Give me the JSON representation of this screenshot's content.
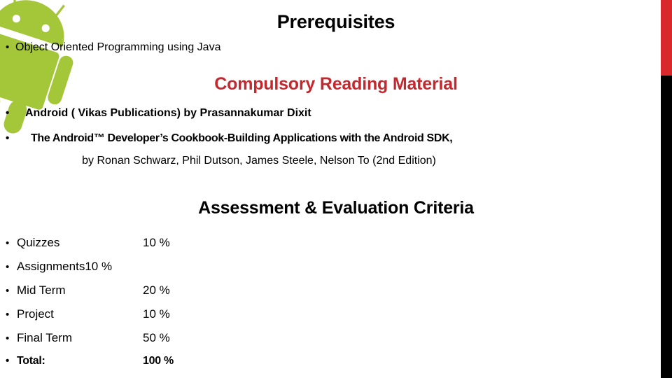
{
  "slide": {
    "title": "Prerequisites",
    "prerequisites": [
      {
        "bullet": "•",
        "text": "Object Oriented Programming using Java"
      }
    ],
    "reading_heading": "Compulsory Reading Material",
    "reading_items": [
      {
        "bullet": "•",
        "text": "Android ( Vikas Publications) by Prasannakumar Dixit"
      },
      {
        "bullet": "•",
        "text": "The Android™ Developer’s Cookbook-Building Applications with the Android SDK,"
      }
    ],
    "reading_byline": "by Ronan Schwarz, Phil Dutson, James Steele, Nelson To (2nd Edition)",
    "assessment_heading": "Assessment & Evaluation Criteria",
    "assessment_rows": [
      {
        "bullet": "•",
        "label": "Quizzes",
        "percent": "10 %",
        "joined": false,
        "total": false
      },
      {
        "bullet": "•",
        "label": "Assignments",
        "percent": "10 %",
        "joined": true,
        "total": false
      },
      {
        "bullet": "•",
        "label": "Mid Term",
        "percent": "20 %",
        "joined": false,
        "total": false
      },
      {
        "bullet": "•",
        "label": "Project",
        "percent": "10 %",
        "joined": false,
        "total": false
      },
      {
        "bullet": "•",
        "label": "Final Term",
        "percent": "50 %",
        "joined": false,
        "total": false
      },
      {
        "bullet": "•",
        "label": "Total:",
        "percent": "100 %",
        "joined": false,
        "total": true
      }
    ]
  },
  "decor": {
    "mascot_name": "android-robot-logo",
    "mascot_color": "#a4c639",
    "accent_red": "#d9282c",
    "accent_black": "#000000",
    "heading_red": "#c3282e",
    "text_black": "#000000"
  }
}
